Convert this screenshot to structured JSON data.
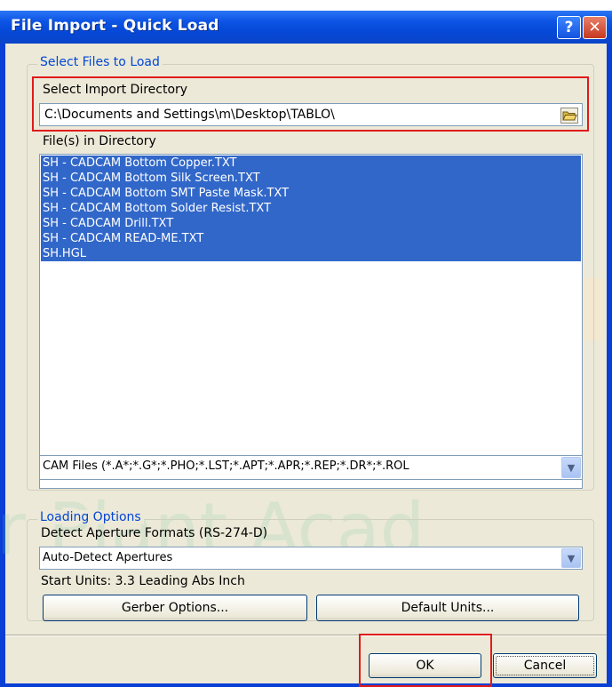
{
  "above_window_text": "",
  "window": {
    "title": "File Import - Quick Load",
    "help_glyph": "?",
    "close_glyph": "✕"
  },
  "select_files_group": {
    "title": "Select Files to Load",
    "import_dir_label": "Select Import Directory",
    "import_dir_value": "C:\\Documents and Settings\\m\\Desktop\\TABLO\\",
    "files_label": "File(s) in Directory",
    "files": [
      "SH - CADCAM Bottom Copper.TXT",
      "SH - CADCAM Bottom Silk Screen.TXT",
      "SH - CADCAM Bottom SMT Paste Mask.TXT",
      "SH - CADCAM Bottom Solder Resist.TXT",
      "SH - CADCAM Drill.TXT",
      "SH - CADCAM READ-ME.TXT",
      "SH.HGL"
    ],
    "file_filter_value": "CAM Files (*.A*;*.G*;*.PHO;*.LST;*.APT;*.APR;*.REP;*.DR*;*.ROL"
  },
  "loading_options_group": {
    "title": "Loading Options",
    "aperture_label": "Detect Aperture Formats (RS-274-D)",
    "aperture_value": "Auto-Detect Apertures",
    "start_units_text": "Start Units: 3.3 Leading Abs Inch",
    "gerber_options_label": "Gerber Options...",
    "default_units_label": "Default Units..."
  },
  "buttons": {
    "ok_label": "OK",
    "cancel_label": "Cancel"
  },
  "watermark_text": "r  Plant  Acad",
  "colors": {
    "title_bar": "#0549d8",
    "selection": "#3167c9",
    "group_title": "#0046d5",
    "highlight_box": "#e01b1b"
  }
}
